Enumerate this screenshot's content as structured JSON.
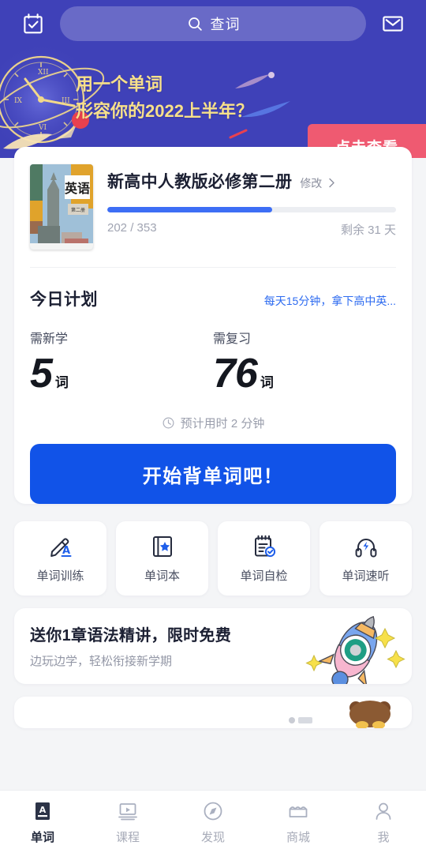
{
  "header": {
    "calendar_icon": "calendar-check-icon",
    "mail_icon": "mail-envelope-icon",
    "search": {
      "icon": "search-icon",
      "placeholder": "查词",
      "value": "查词"
    }
  },
  "banner": {
    "line1": "用一个单词",
    "line2": "形容你的2022上半年？",
    "cta_label": "点击查看",
    "cta_color": "#EF5A71",
    "text_color": "#F7E08A",
    "background_color": "#3F41B8",
    "art": "clock-planet-comet-illustration"
  },
  "book_card": {
    "cover_label": "英语",
    "cover_sub": "第二册",
    "title": "新高中人教版必修第二册",
    "edit_label": "修改",
    "chevron_icon": "chevron-right-icon",
    "progress": {
      "current": 202,
      "total": 353,
      "percent": 57,
      "display": "202 / 353",
      "fill_color": "#3D6EF5"
    },
    "remaining": "剩余 31 天"
  },
  "plan": {
    "title": "今日计划",
    "link": "每天15分钟，拿下高中英...",
    "link_color": "#2D6BF0",
    "stats": [
      {
        "label": "需新学",
        "value": "5",
        "unit": "词"
      },
      {
        "label": "需复习",
        "value": "76",
        "unit": "词"
      }
    ],
    "estimate_icon": "clock-icon",
    "estimate": "预计用时 2 分钟",
    "start_label": "开始背单词吧！",
    "start_color": "#1153E8"
  },
  "tiles": [
    {
      "icon": "pencil-letter-a-icon",
      "label": "单词训练"
    },
    {
      "icon": "book-star-icon",
      "label": "单词本"
    },
    {
      "icon": "notepad-check-icon",
      "label": "单词自检"
    },
    {
      "icon": "headphones-bolt-icon",
      "label": "单词速听"
    }
  ],
  "promo": {
    "title": "送你1章语法精讲，限时免费",
    "subtitle": "边玩边学，轻松衔接新学期",
    "art": "rocket-sparkles-illustration"
  },
  "next_card": {
    "art": "bear-illustration"
  },
  "bottom_nav": {
    "items": [
      {
        "icon": "book-a-icon",
        "label": "单词",
        "active": true
      },
      {
        "icon": "video-course-icon",
        "label": "课程",
        "active": false
      },
      {
        "icon": "compass-icon",
        "label": "发现",
        "active": false
      },
      {
        "icon": "store-icon",
        "label": "商城",
        "active": false
      },
      {
        "icon": "person-icon",
        "label": "我",
        "active": false
      }
    ]
  }
}
